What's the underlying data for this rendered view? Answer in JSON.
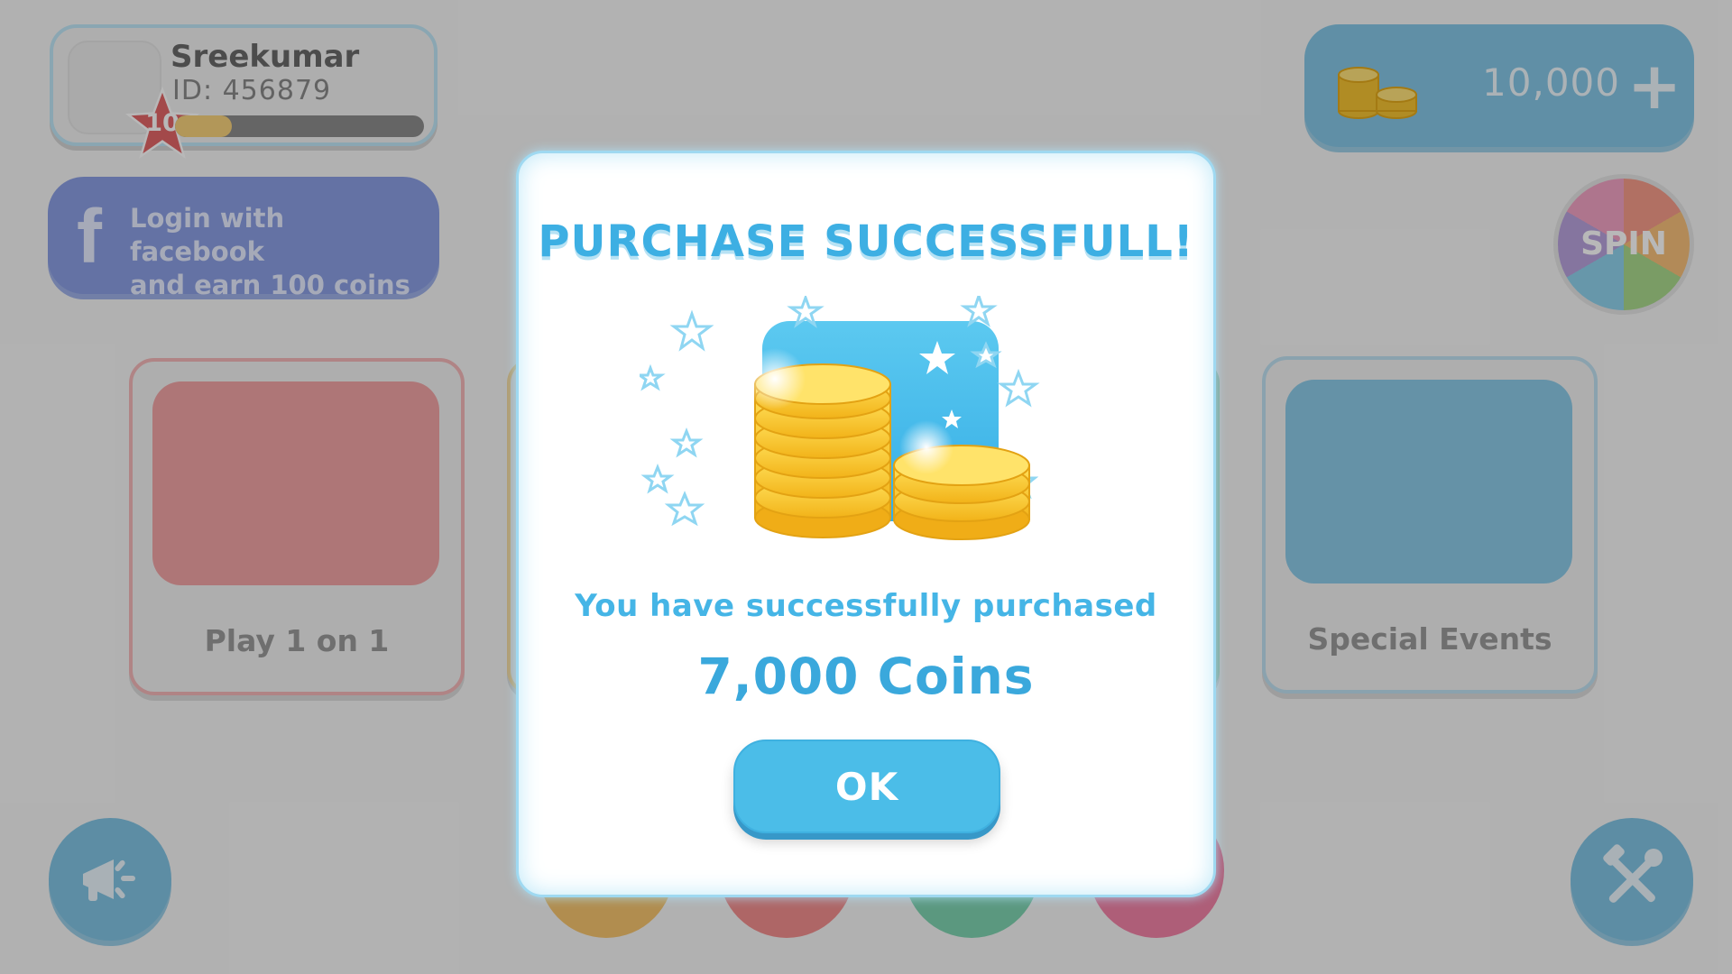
{
  "profile": {
    "username": "Sreekumar",
    "user_id": "ID: 456879",
    "level": "10",
    "xp_progress": 0.23
  },
  "facebook": {
    "icon": "facebook-icon",
    "label_line1": "Login with facebook",
    "label_line2": "and earn 100 coins"
  },
  "wallet": {
    "coin_balance": "10,000",
    "add_label": "+"
  },
  "spin": {
    "label": "SPIN"
  },
  "modes": [
    {
      "label": "Play 1 on 1",
      "color": "#f2a4a6"
    },
    {
      "label": "Special Events",
      "color": "#8ccbe8"
    }
  ],
  "bottom_buttons": [
    {
      "icon": "megaphone-icon"
    },
    {
      "icon": "tools-icon"
    }
  ],
  "dialog": {
    "title": "PURCHASE SUCCESSFULL!",
    "message": "You have successfully purchased",
    "amount": "7,000 Coins",
    "ok_label": "OK"
  },
  "colors": {
    "accent_blue": "#3dafe3",
    "coin_gold": "#f6c42b",
    "facebook_blue": "#8b9fe3"
  }
}
